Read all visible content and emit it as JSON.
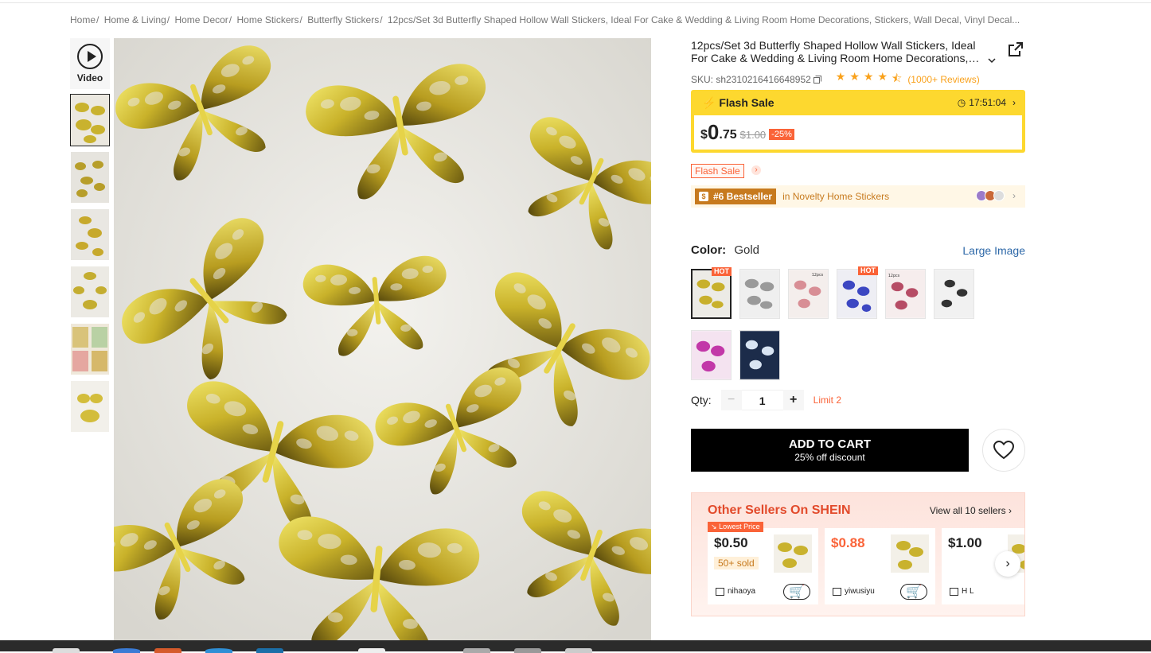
{
  "breadcrumb": {
    "items": [
      "Home",
      "Home & Living",
      "Home Decor",
      "Home Stickers",
      "Butterfly Stickers"
    ],
    "current": "12pcs/Set 3d Butterfly Shaped Hollow Wall Stickers, Ideal For Cake & Wedding & Living Room Home Decorations, Stickers, Wall Decal, Vinyl Decal..."
  },
  "gallery": {
    "video_label": "Video"
  },
  "product": {
    "title": "12pcs/Set 3d Butterfly Shaped Hollow Wall Stickers, Ideal For Cake & Wedding & Living Room Home Decorations, Stickers, Wall Decal, Vinyl Decal",
    "sku": "SKU: sh2310216416648952",
    "rating": 4.5,
    "reviews": "(1000+ Reviews)"
  },
  "flash": {
    "label": "Flash Sale",
    "timer": "17:51:04",
    "currency": "$",
    "price_int": "0",
    "price_dec": ".75",
    "original": "$1.00",
    "discount": "-25%",
    "tag": "Flash Sale"
  },
  "bestseller": {
    "badge": "#6 Bestseller",
    "category": "in Novelty Home Stickers"
  },
  "color": {
    "label": "Color:",
    "value": "Gold",
    "large_image": "Large Image",
    "hot_label": "HOT",
    "swatch_text": "12pcs",
    "swatches": [
      {
        "name": "Gold",
        "hot": true
      },
      {
        "name": "Silver",
        "hot": false
      },
      {
        "name": "Pink",
        "hot": false
      },
      {
        "name": "Blue",
        "hot": true
      },
      {
        "name": "Rose",
        "hot": false
      },
      {
        "name": "Black",
        "hot": false
      },
      {
        "name": "Purple",
        "hot": false
      },
      {
        "name": "Navy",
        "hot": false
      }
    ]
  },
  "qty": {
    "label": "Qty:",
    "value": "1",
    "minus": "−",
    "plus": "+",
    "limit": "Limit 2"
  },
  "cart": {
    "label": "ADD TO CART",
    "sub": "25% off discount"
  },
  "sellers": {
    "title": "Other Sellers On SHEIN",
    "view_all": "View all 10 sellers",
    "lowest_label": "Lowest Price",
    "cards": [
      {
        "price": "$0.50",
        "sold": "50+ sold",
        "shop": "nihaoya"
      },
      {
        "price": "$0.88",
        "sold": "",
        "shop": "yiwusiyu"
      },
      {
        "price": "$1.00",
        "sold": "",
        "shop": "H L"
      }
    ]
  },
  "colors": {
    "accent": "#fa6338",
    "flash_yellow": "#fdd82f",
    "star": "#f9a11b",
    "link": "#2d68a8"
  },
  "icons": [
    "play-icon",
    "share-icon",
    "chevron-down-icon",
    "copy-icon",
    "star-icon",
    "lightning-icon",
    "clock-icon",
    "chevron-right-icon",
    "medal-icon",
    "heart-icon",
    "store-icon",
    "add-cart-icon"
  ]
}
